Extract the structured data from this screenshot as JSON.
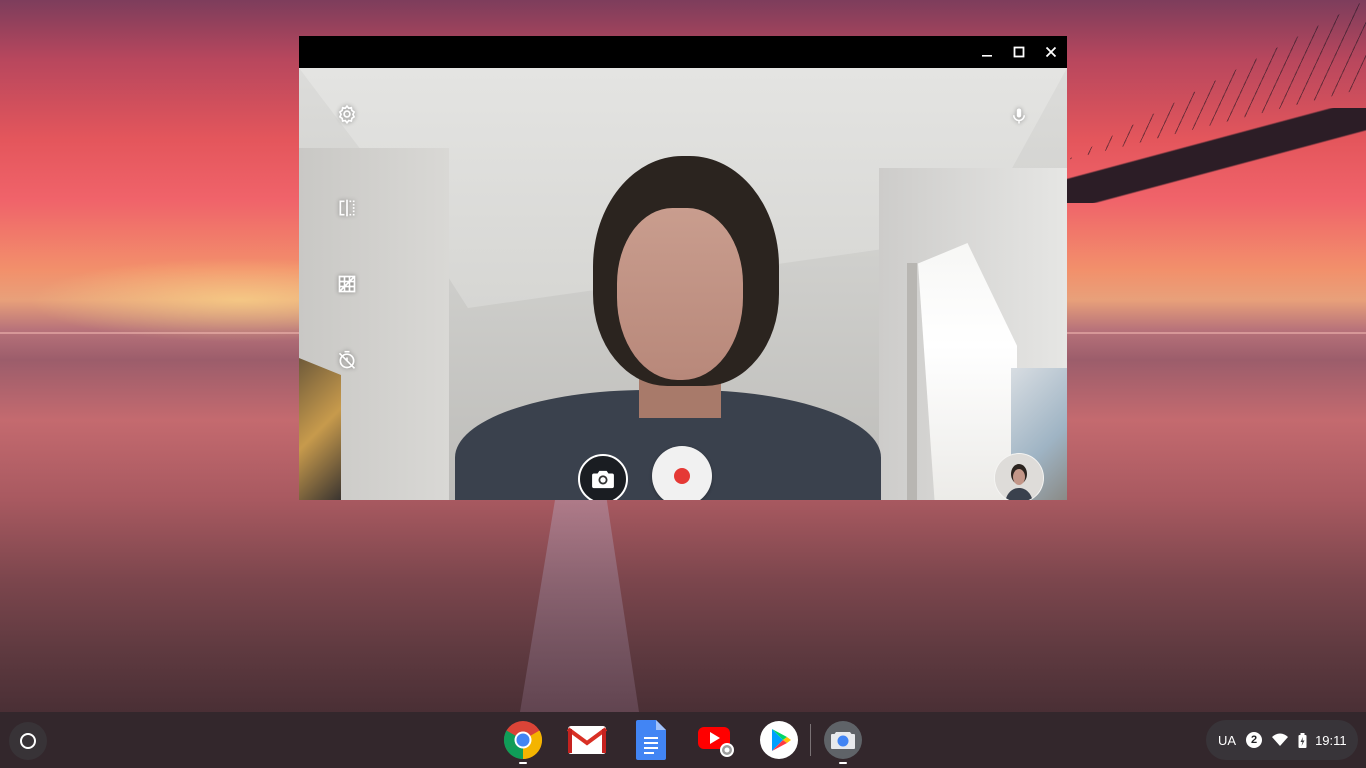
{
  "desktop": {
    "wallpaper": "sunset-beach-bridge"
  },
  "window": {
    "app": "Camera",
    "controls": {
      "minimize": "minimize-icon",
      "maximize": "maximize-icon",
      "close": "close-icon"
    }
  },
  "camera": {
    "left_toolbar": [
      "gear-icon",
      "mirror-icon",
      "grid-icon",
      "timer-off-icon"
    ],
    "mic_icon": "mic-icon",
    "mode_buttons": {
      "photo": "camera-icon",
      "record": "record-icon"
    },
    "record_color": "#e53935"
  },
  "shelf": {
    "launcher_icon": "launcher-icon",
    "apps": [
      "chrome",
      "gmail",
      "docs",
      "youtube",
      "play-store",
      "camera"
    ],
    "tray": {
      "ime": "UA",
      "notification_count": "2",
      "wifi_icon": "wifi-icon",
      "battery_icon": "battery-icon",
      "time": "19:11"
    }
  }
}
